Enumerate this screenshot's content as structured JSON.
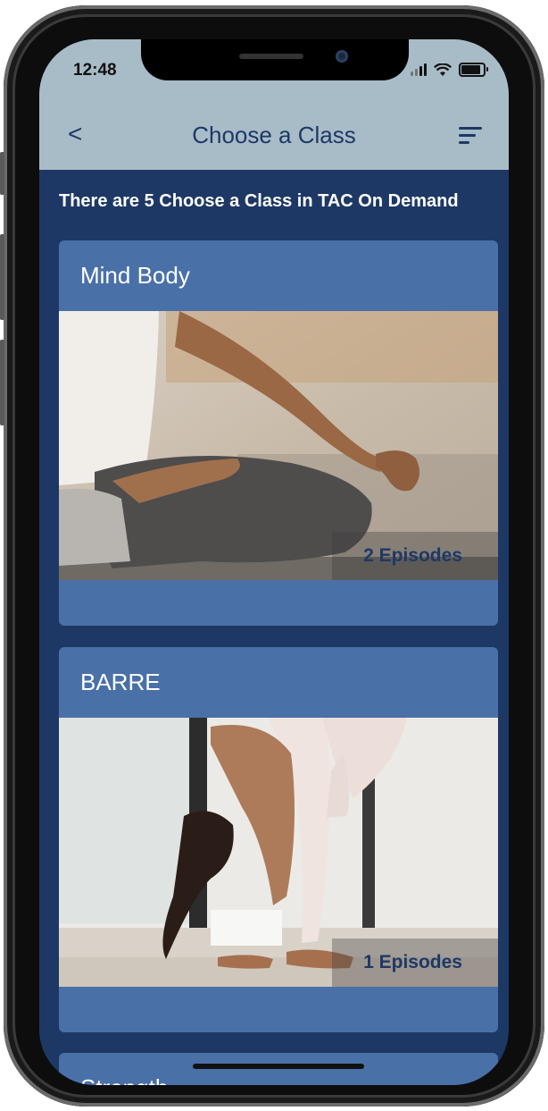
{
  "status_bar": {
    "time": "12:48",
    "icons": [
      "signal-icon",
      "wifi-icon",
      "battery-icon"
    ]
  },
  "nav": {
    "back_glyph": "<",
    "title": "Choose a Class",
    "sort_icon": "sort-icon"
  },
  "subtitle": "There are 5 Choose a Class in TAC On Demand",
  "cards": [
    {
      "title": "Mind Body",
      "episodes": "2 Episodes",
      "image": "yoga-meditation-photo"
    },
    {
      "title": "BARRE",
      "episodes": "1 Episodes",
      "image": "forward-fold-stretch-photo"
    },
    {
      "title": "Strength",
      "episodes": "",
      "image": ""
    }
  ],
  "colors": {
    "header": "#a8bcc8",
    "background": "#1e3866",
    "card": "#4a70a8",
    "accent_text": "#1e3866"
  }
}
